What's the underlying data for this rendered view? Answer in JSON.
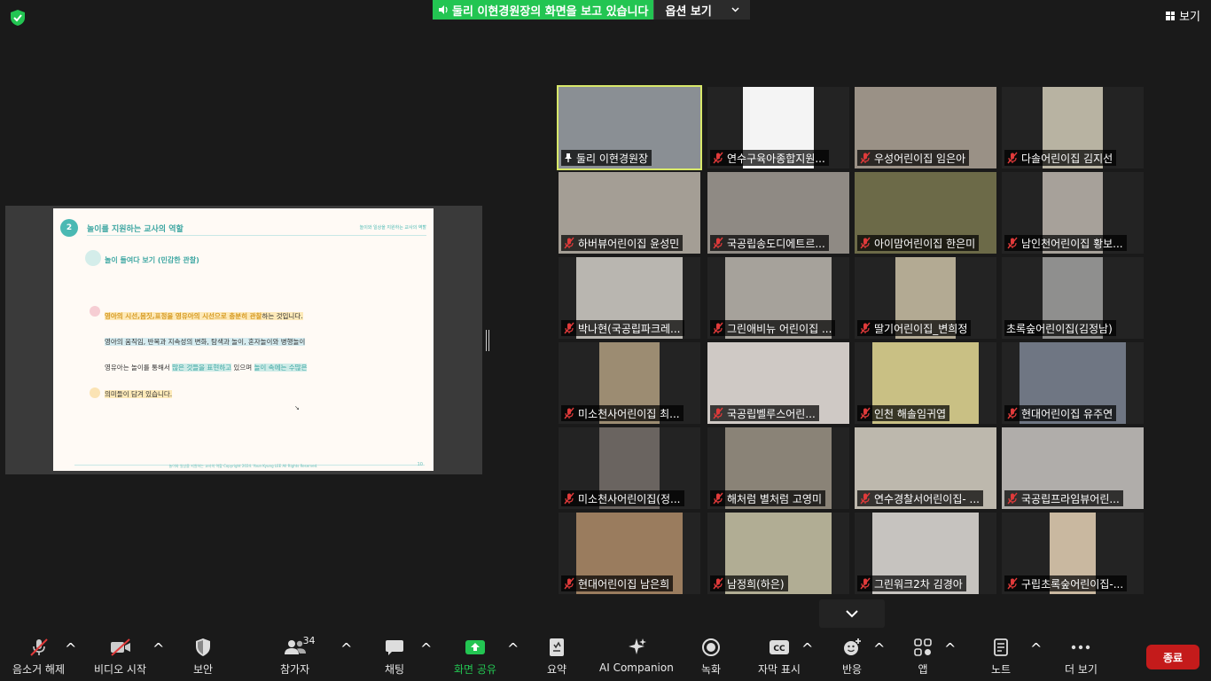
{
  "top": {
    "share_text": "둘리 이현경원장의 화면을 보고 있습니다",
    "options_label": "옵션 보기",
    "view_label": "보기"
  },
  "slide": {
    "number": "2",
    "title": "놀이를 지원하는 교사의 역할",
    "header_right": "놀이와 일상을 지원하는 교사의 역할",
    "subtitle": "놀이 들여다 보기 (민감한 관찰)",
    "line1_hl": "영아의 시선,몸짓,표정을 영유아의 시선으로 충분히 관찰",
    "line1_rest": "하는 것입니다.",
    "line2": "영아의 움직임, 반복과 지속성의 변화, 탐색과 놀이, 혼자놀이와 병행놀이",
    "line3_a": "영유아는 놀이를 통해서 ",
    "line3_b": "많은 것들을 표현하고",
    "line3_c": " 있으며 ",
    "line3_d": "놀이 속에는 수많은",
    "line4": "의미들이 담겨 있습니다.",
    "footer": "놀이와 일상을 지원하는 교사의 역할 Copyright 2024. Youn Kyung LEE All Rights Reserved.",
    "page": "10"
  },
  "participants": [
    {
      "name": "둘리 이현경원장",
      "muted": false,
      "active": true
    },
    {
      "name": "연수구육아종합지원...",
      "muted": true
    },
    {
      "name": "우성어린이집 임은아",
      "muted": true
    },
    {
      "name": "다솔어린이집 김지선",
      "muted": true
    },
    {
      "name": "하버뷰어린이집 윤성민",
      "muted": true
    },
    {
      "name": "국공립송도디에트르...",
      "muted": true
    },
    {
      "name": "아이맘어린이집 한은미",
      "muted": true
    },
    {
      "name": "남인천어린이집 황보...",
      "muted": true
    },
    {
      "name": "박나현(국공립파크레...",
      "muted": true
    },
    {
      "name": "그린애비뉴 어린이집 ...",
      "muted": true
    },
    {
      "name": "딸기어린이집_변희정",
      "muted": true
    },
    {
      "name": "초록숲어린이집(김정남)",
      "muted": false
    },
    {
      "name": "미소천사어린이집 최...",
      "muted": true
    },
    {
      "name": "국공립벨루스어린...",
      "muted": true
    },
    {
      "name": "인천 해솔임귀엽",
      "muted": true
    },
    {
      "name": "현대어린이집 유주연",
      "muted": true
    },
    {
      "name": "미소천사어린이집(정...",
      "muted": true
    },
    {
      "name": "해처럼 별처럼 고영미",
      "muted": true
    },
    {
      "name": "연수경찰서어린이집- ...",
      "muted": true
    },
    {
      "name": "국공립프라임뷰어린...",
      "muted": true
    },
    {
      "name": "현대어린이집 남은희",
      "muted": true
    },
    {
      "name": "남정희(하은)",
      "muted": true
    },
    {
      "name": "그린워크2차 김경아",
      "muted": true
    },
    {
      "name": "구립초록숲어린이집-...",
      "muted": true
    }
  ],
  "toolbar": {
    "unmute": "음소거 해제",
    "start_video": "비디오 시작",
    "security": "보안",
    "participants": "참가자",
    "participant_count": "34",
    "chat": "채팅",
    "share_screen": "화면 공유",
    "summary": "요약",
    "ai_companion": "AI Companion",
    "record": "녹화",
    "captions": "자막 표시",
    "reactions": "반응",
    "apps": "앱",
    "notes": "노트",
    "more": "더 보기",
    "end": "종료"
  },
  "colors": {
    "share_green": "#23c552",
    "active_outline": "#d8e86a",
    "end_red": "#c41b1b",
    "mute_red": "#e03a3a"
  },
  "icons": [
    "shield-icon",
    "speaker-icon",
    "chevron-down-icon",
    "grid-icon",
    "mic-off-icon",
    "pin-icon",
    "video-off-icon",
    "security-icon",
    "participants-icon",
    "chat-icon",
    "share-screen-icon",
    "summary-icon",
    "ai-companion-icon",
    "record-icon",
    "cc-icon",
    "reaction-icon",
    "apps-icon",
    "notes-icon",
    "more-icon"
  ]
}
